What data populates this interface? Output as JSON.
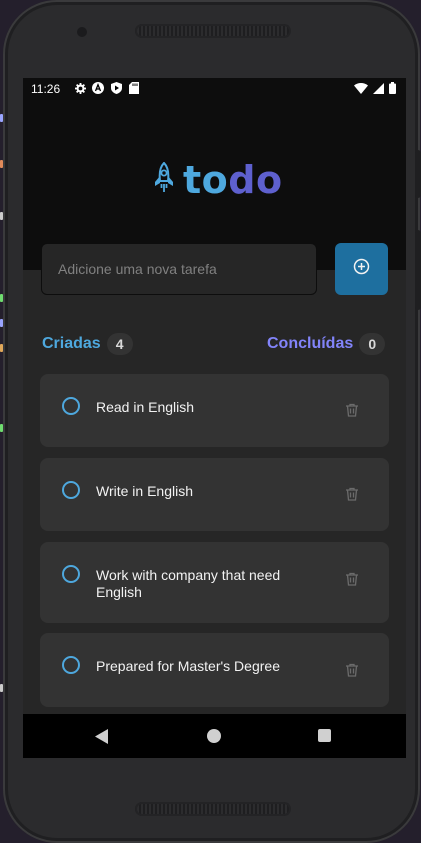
{
  "status_bar": {
    "time": "11:26",
    "left_icons": [
      "settings-icon",
      "a-badge-icon",
      "shield-play-icon",
      "sd-card-icon"
    ],
    "right_icons": [
      "wifi-icon",
      "cell-signal-icon",
      "battery-icon"
    ]
  },
  "header": {
    "logo_part1": "to",
    "logo_part2": "do",
    "colors": {
      "to": "#4ea8de",
      "do": "#5e60ce",
      "rocket": "#4ea8de"
    }
  },
  "new_task": {
    "placeholder": "Adicione uma nova tarefa",
    "add_icon": "plus-circle-icon"
  },
  "counters": {
    "created_label": "Criadas",
    "created_count": "4",
    "done_label": "Concluídas",
    "done_count": "0",
    "colors": {
      "created": "#4ea8de",
      "done": "#8284fa"
    }
  },
  "tasks": [
    {
      "text": "Read in English",
      "done": false
    },
    {
      "text": "Write in English",
      "done": false
    },
    {
      "text": "Work with company that need English",
      "done": false
    },
    {
      "text": "Prepared for Master's Degree",
      "done": false
    }
  ],
  "nav_bar": {
    "icons": [
      "back-triangle-icon",
      "home-circle-icon",
      "recents-square-icon"
    ]
  }
}
